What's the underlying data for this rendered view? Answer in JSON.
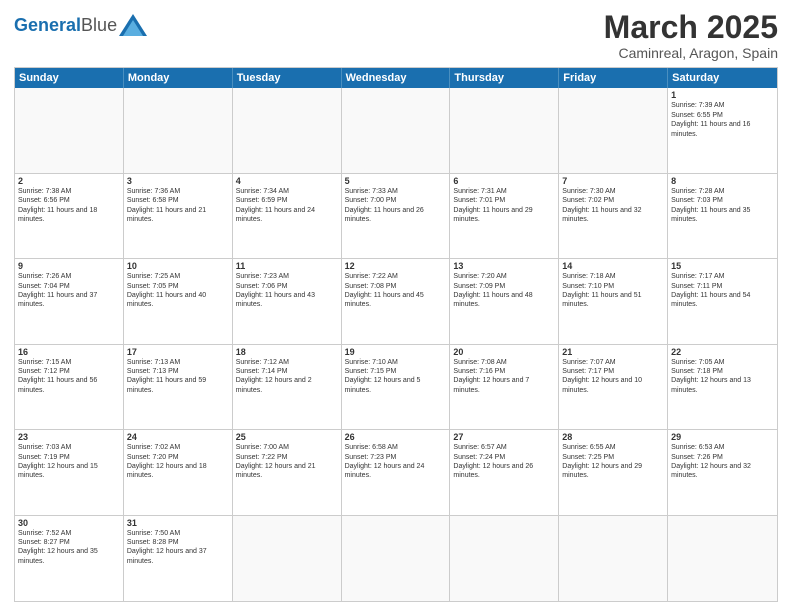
{
  "header": {
    "logo": "GeneralBlue",
    "month": "March 2025",
    "location": "Caminreal, Aragon, Spain"
  },
  "days": [
    "Sunday",
    "Monday",
    "Tuesday",
    "Wednesday",
    "Thursday",
    "Friday",
    "Saturday"
  ],
  "weeks": [
    [
      {
        "num": "",
        "text": ""
      },
      {
        "num": "",
        "text": ""
      },
      {
        "num": "",
        "text": ""
      },
      {
        "num": "",
        "text": ""
      },
      {
        "num": "",
        "text": ""
      },
      {
        "num": "",
        "text": ""
      },
      {
        "num": "1",
        "text": "Sunrise: 7:39 AM\nSunset: 6:55 PM\nDaylight: 11 hours and 16 minutes."
      }
    ],
    [
      {
        "num": "2",
        "text": "Sunrise: 7:38 AM\nSunset: 6:56 PM\nDaylight: 11 hours and 18 minutes."
      },
      {
        "num": "3",
        "text": "Sunrise: 7:36 AM\nSunset: 6:58 PM\nDaylight: 11 hours and 21 minutes."
      },
      {
        "num": "4",
        "text": "Sunrise: 7:34 AM\nSunset: 6:59 PM\nDaylight: 11 hours and 24 minutes."
      },
      {
        "num": "5",
        "text": "Sunrise: 7:33 AM\nSunset: 7:00 PM\nDaylight: 11 hours and 26 minutes."
      },
      {
        "num": "6",
        "text": "Sunrise: 7:31 AM\nSunset: 7:01 PM\nDaylight: 11 hours and 29 minutes."
      },
      {
        "num": "7",
        "text": "Sunrise: 7:30 AM\nSunset: 7:02 PM\nDaylight: 11 hours and 32 minutes."
      },
      {
        "num": "8",
        "text": "Sunrise: 7:28 AM\nSunset: 7:03 PM\nDaylight: 11 hours and 35 minutes."
      }
    ],
    [
      {
        "num": "9",
        "text": "Sunrise: 7:26 AM\nSunset: 7:04 PM\nDaylight: 11 hours and 37 minutes."
      },
      {
        "num": "10",
        "text": "Sunrise: 7:25 AM\nSunset: 7:05 PM\nDaylight: 11 hours and 40 minutes."
      },
      {
        "num": "11",
        "text": "Sunrise: 7:23 AM\nSunset: 7:06 PM\nDaylight: 11 hours and 43 minutes."
      },
      {
        "num": "12",
        "text": "Sunrise: 7:22 AM\nSunset: 7:08 PM\nDaylight: 11 hours and 45 minutes."
      },
      {
        "num": "13",
        "text": "Sunrise: 7:20 AM\nSunset: 7:09 PM\nDaylight: 11 hours and 48 minutes."
      },
      {
        "num": "14",
        "text": "Sunrise: 7:18 AM\nSunset: 7:10 PM\nDaylight: 11 hours and 51 minutes."
      },
      {
        "num": "15",
        "text": "Sunrise: 7:17 AM\nSunset: 7:11 PM\nDaylight: 11 hours and 54 minutes."
      }
    ],
    [
      {
        "num": "16",
        "text": "Sunrise: 7:15 AM\nSunset: 7:12 PM\nDaylight: 11 hours and 56 minutes."
      },
      {
        "num": "17",
        "text": "Sunrise: 7:13 AM\nSunset: 7:13 PM\nDaylight: 11 hours and 59 minutes."
      },
      {
        "num": "18",
        "text": "Sunrise: 7:12 AM\nSunset: 7:14 PM\nDaylight: 12 hours and 2 minutes."
      },
      {
        "num": "19",
        "text": "Sunrise: 7:10 AM\nSunset: 7:15 PM\nDaylight: 12 hours and 5 minutes."
      },
      {
        "num": "20",
        "text": "Sunrise: 7:08 AM\nSunset: 7:16 PM\nDaylight: 12 hours and 7 minutes."
      },
      {
        "num": "21",
        "text": "Sunrise: 7:07 AM\nSunset: 7:17 PM\nDaylight: 12 hours and 10 minutes."
      },
      {
        "num": "22",
        "text": "Sunrise: 7:05 AM\nSunset: 7:18 PM\nDaylight: 12 hours and 13 minutes."
      }
    ],
    [
      {
        "num": "23",
        "text": "Sunrise: 7:03 AM\nSunset: 7:19 PM\nDaylight: 12 hours and 15 minutes."
      },
      {
        "num": "24",
        "text": "Sunrise: 7:02 AM\nSunset: 7:20 PM\nDaylight: 12 hours and 18 minutes."
      },
      {
        "num": "25",
        "text": "Sunrise: 7:00 AM\nSunset: 7:22 PM\nDaylight: 12 hours and 21 minutes."
      },
      {
        "num": "26",
        "text": "Sunrise: 6:58 AM\nSunset: 7:23 PM\nDaylight: 12 hours and 24 minutes."
      },
      {
        "num": "27",
        "text": "Sunrise: 6:57 AM\nSunset: 7:24 PM\nDaylight: 12 hours and 26 minutes."
      },
      {
        "num": "28",
        "text": "Sunrise: 6:55 AM\nSunset: 7:25 PM\nDaylight: 12 hours and 29 minutes."
      },
      {
        "num": "29",
        "text": "Sunrise: 6:53 AM\nSunset: 7:26 PM\nDaylight: 12 hours and 32 minutes."
      }
    ],
    [
      {
        "num": "30",
        "text": "Sunrise: 7:52 AM\nSunset: 8:27 PM\nDaylight: 12 hours and 35 minutes."
      },
      {
        "num": "31",
        "text": "Sunrise: 7:50 AM\nSunset: 8:28 PM\nDaylight: 12 hours and 37 minutes."
      },
      {
        "num": "",
        "text": ""
      },
      {
        "num": "",
        "text": ""
      },
      {
        "num": "",
        "text": ""
      },
      {
        "num": "",
        "text": ""
      },
      {
        "num": "",
        "text": ""
      }
    ]
  ]
}
